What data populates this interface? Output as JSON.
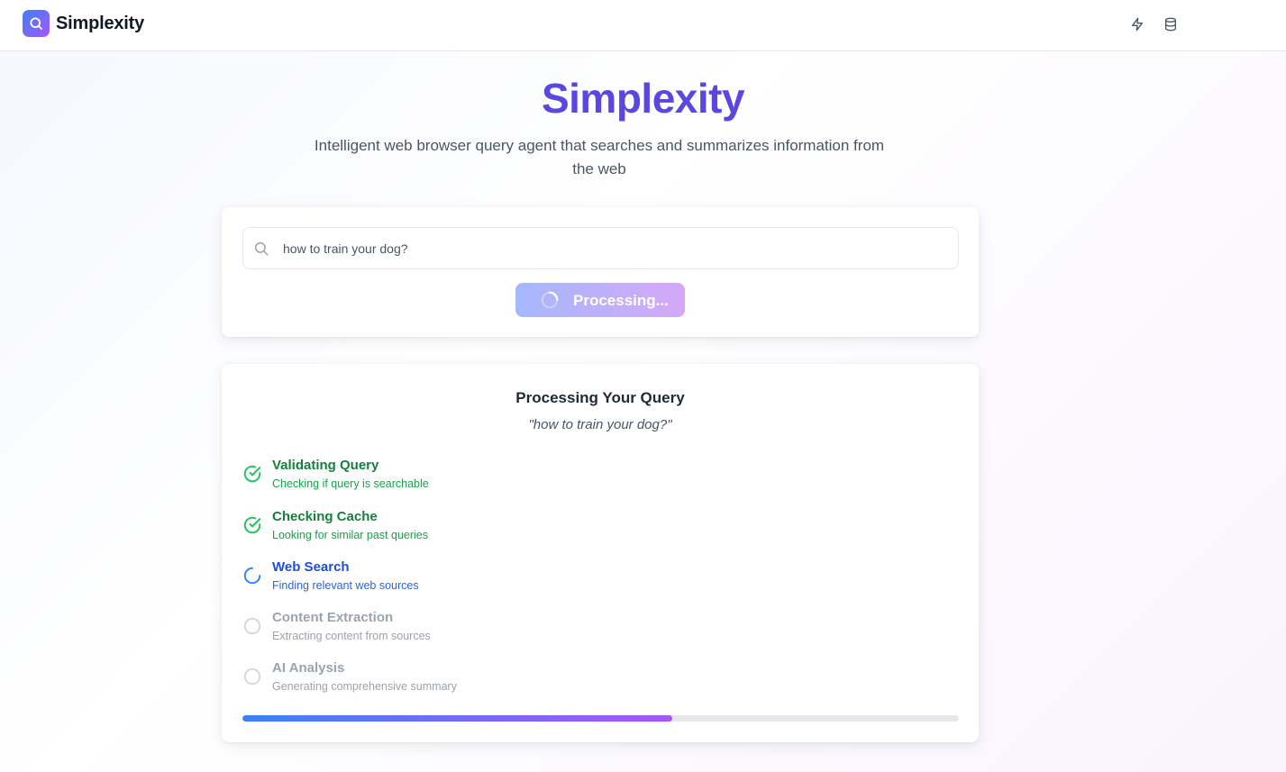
{
  "header": {
    "brand": "Simplexity",
    "icons": [
      "zap-icon",
      "database-icon"
    ]
  },
  "hero": {
    "title": "Simplexity",
    "subtitle": "Intelligent web browser query agent that searches and summarizes information from the web"
  },
  "search": {
    "value": "how to train your dog?",
    "button_label": "Processing..."
  },
  "progress": {
    "title": "Processing Your Query",
    "query": "\"how to train your dog?\"",
    "steps": [
      {
        "title": "Validating Query",
        "desc": "Checking if query is searchable",
        "status": "done"
      },
      {
        "title": "Checking Cache",
        "desc": "Looking for similar past queries",
        "status": "done"
      },
      {
        "title": "Web Search",
        "desc": "Finding relevant web sources",
        "status": "active"
      },
      {
        "title": "Content Extraction",
        "desc": "Extracting content from sources",
        "status": "pending"
      },
      {
        "title": "AI Analysis",
        "desc": "Generating comprehensive summary",
        "status": "pending"
      }
    ],
    "percent": 60
  },
  "colors": {
    "accent_blue": "#3b82f6",
    "accent_purple": "#a855f7",
    "done_green": "#16a34a",
    "active_blue": "#2563eb",
    "pending_gray": "#9ca3af",
    "title_indigo": "#5b47e0"
  }
}
